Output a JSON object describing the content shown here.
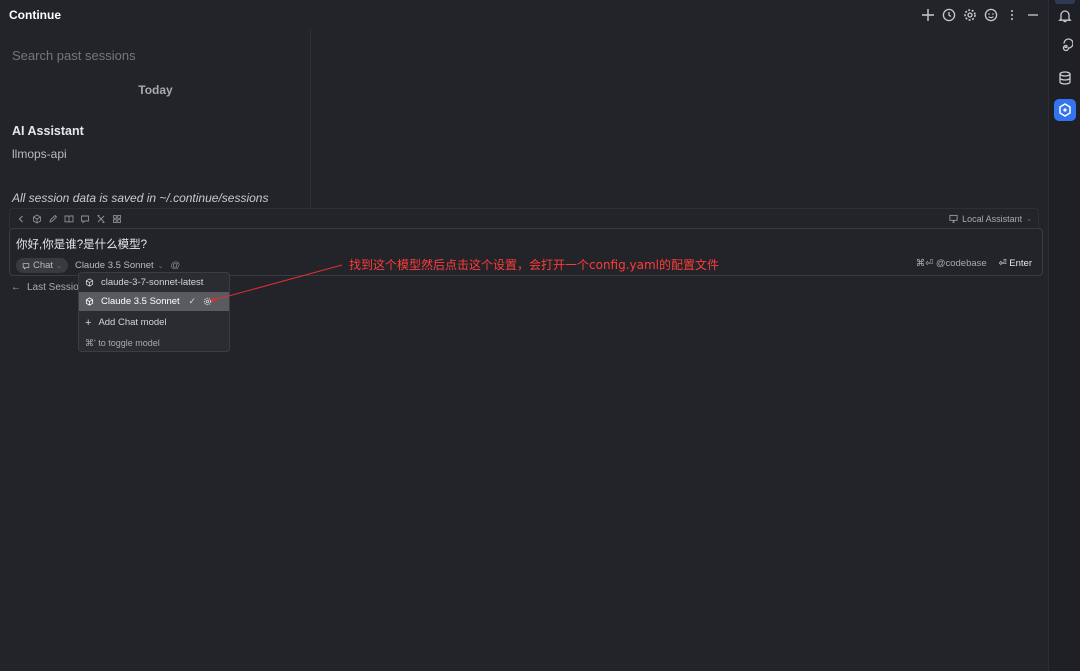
{
  "header": {
    "app_title": "Continue"
  },
  "history": {
    "search_placeholder": "Search past sessions",
    "group_title": "Today",
    "sessions": [
      {
        "title": "AI Assistant",
        "subtitle": "llmops-api"
      }
    ],
    "save_note": "All session data is saved in ~/.continue/sessions"
  },
  "toolbar": {
    "assistant_label": "Local Assistant"
  },
  "input": {
    "prompt_text": "你好,你是谁?是什么模型?",
    "mode_label": "Chat",
    "model_label": "Claude 3.5 Sonnet",
    "at_symbol": "@",
    "codebase_label": "⌘⏎ @codebase",
    "enter_label": "⏎ Enter"
  },
  "last_session": {
    "label": "Last Session"
  },
  "model_dropdown": {
    "items": [
      {
        "label": "claude-3-7-sonnet-latest"
      },
      {
        "label": "Claude 3.5 Sonnet",
        "check": "✓"
      }
    ],
    "add_label": "Add Chat model",
    "hint": "⌘' to toggle model"
  },
  "annotation": {
    "text": "找到这个模型然后点击这个设置，会打开一个config.yaml的配置文件"
  },
  "colors": {
    "accent": "#3574f0",
    "annotation": "#ff3b3b",
    "background": "#232429"
  }
}
